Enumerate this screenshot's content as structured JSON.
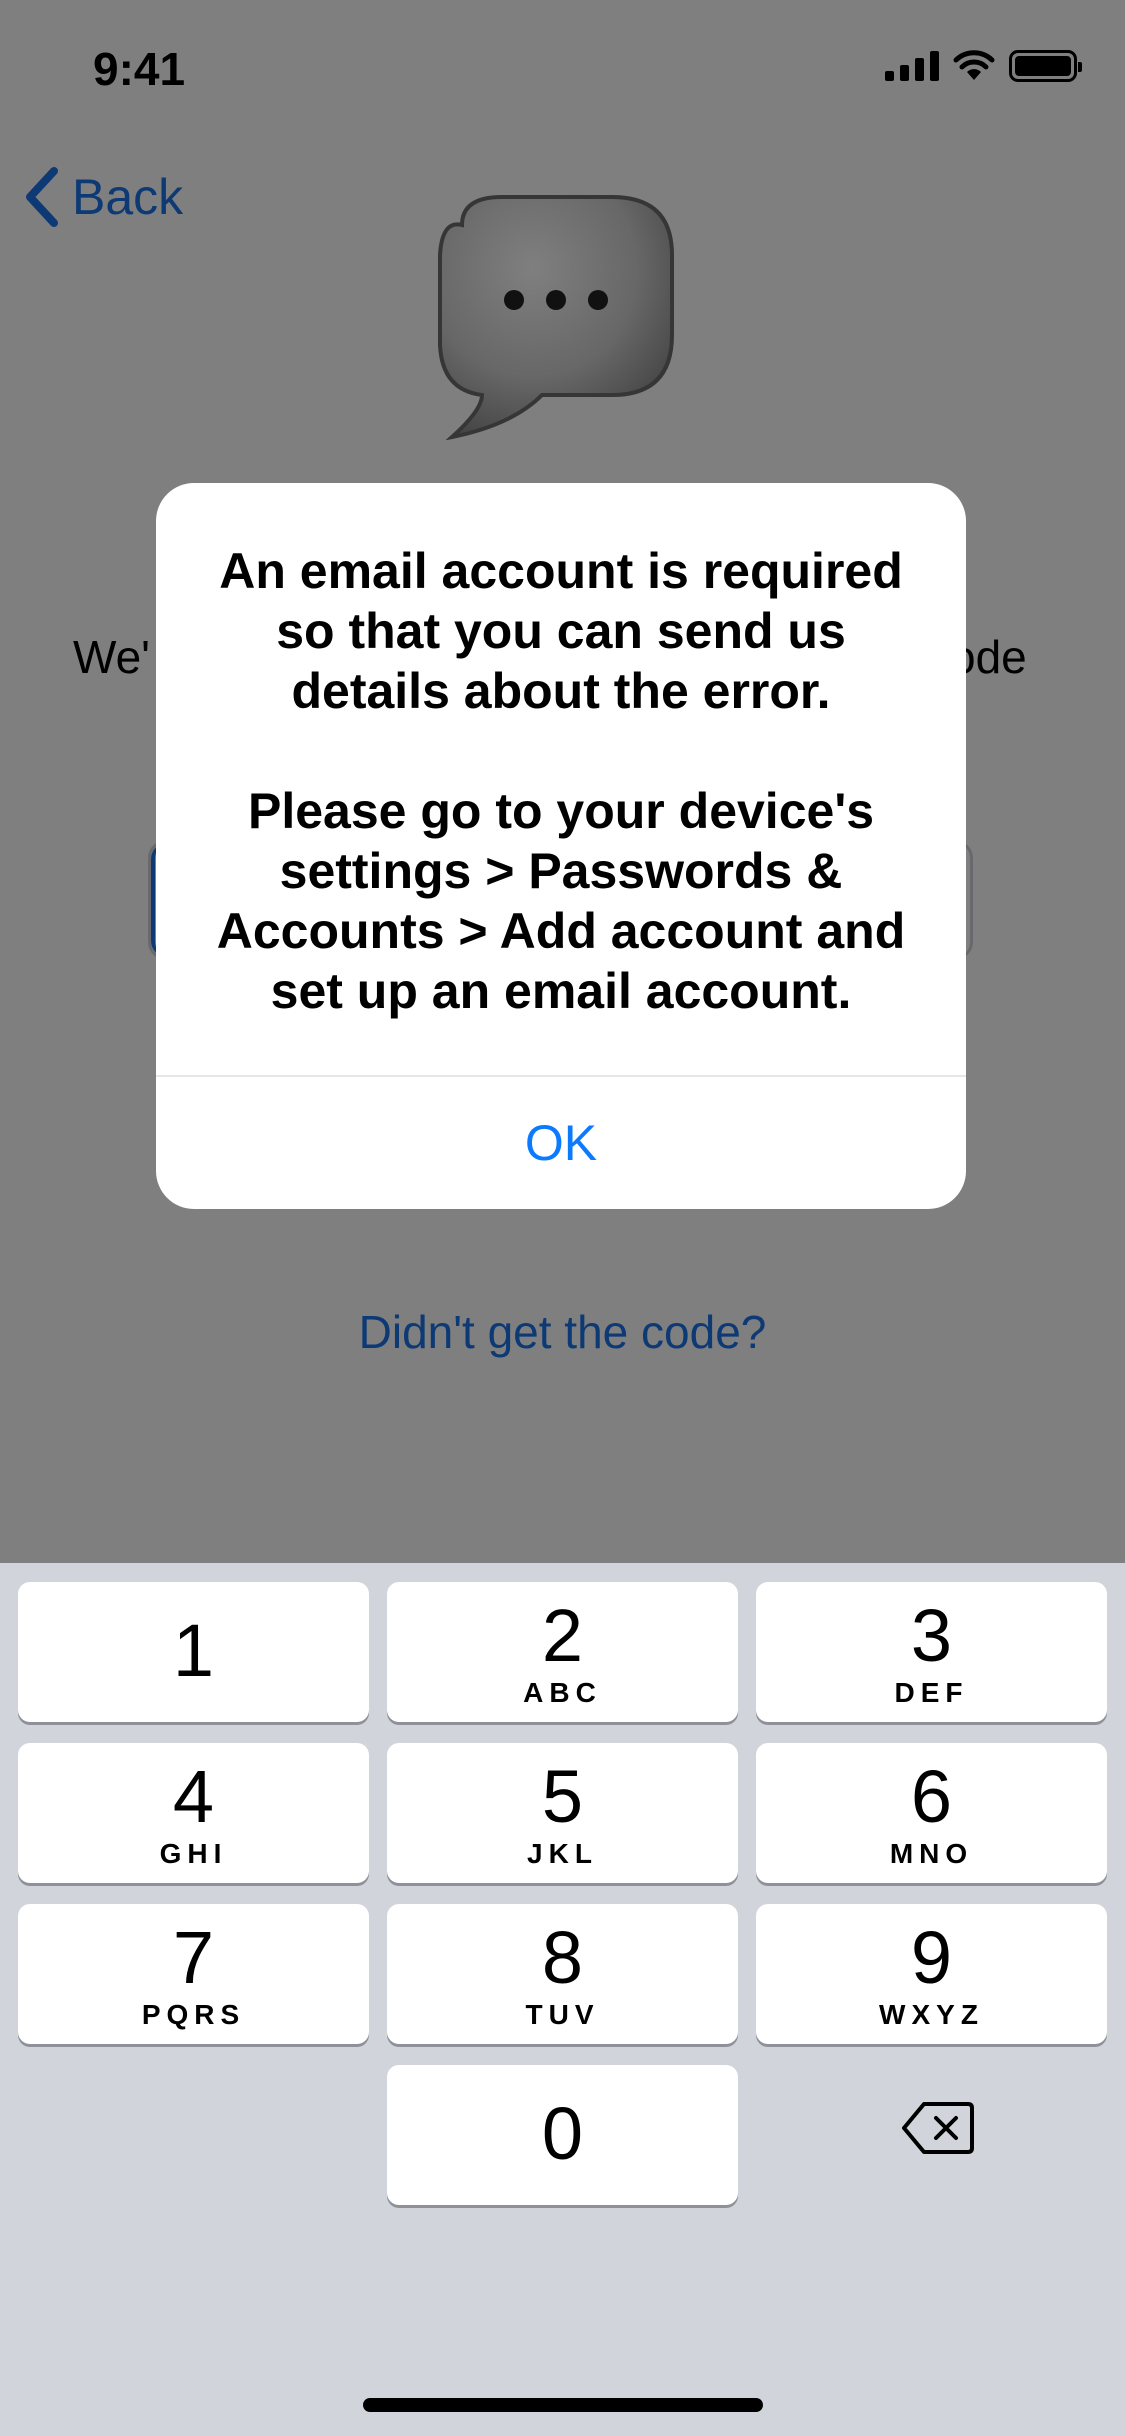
{
  "status_bar": {
    "time": "9:41"
  },
  "nav": {
    "back_label": "Back"
  },
  "screen": {
    "subtitle_left": "We'",
    "subtitle_right": "ode",
    "resend_link": "Didn't get the code?"
  },
  "alert": {
    "message_1": "An email account is required so that you can send us details about the error.",
    "message_2": "Please go to your device's settings > Passwords & Accounts > Add account and set up an email account.",
    "ok_label": "OK"
  },
  "keypad": {
    "keys": [
      {
        "digit": "1",
        "letters": ""
      },
      {
        "digit": "2",
        "letters": "ABC"
      },
      {
        "digit": "3",
        "letters": "DEF"
      },
      {
        "digit": "4",
        "letters": "GHI"
      },
      {
        "digit": "5",
        "letters": "JKL"
      },
      {
        "digit": "6",
        "letters": "MNO"
      },
      {
        "digit": "7",
        "letters": "PQRS"
      },
      {
        "digit": "8",
        "letters": "TUV"
      },
      {
        "digit": "9",
        "letters": "WXYZ"
      },
      {
        "digit": "0",
        "letters": ""
      }
    ]
  },
  "colors": {
    "accent": "#1a73e8",
    "alert_button": "#0a7aff",
    "keypad_bg": "#d1d4db"
  },
  "icons": {
    "back": "chevron-left-icon",
    "bubble": "chat-bubble-icon",
    "delete": "backspace-icon"
  }
}
